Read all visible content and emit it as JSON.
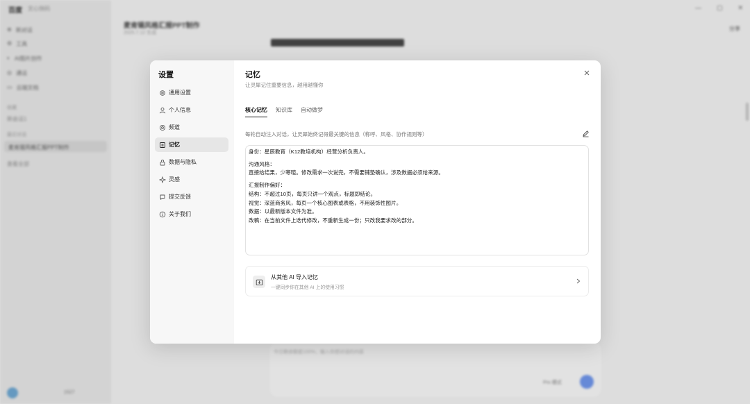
{
  "background": {
    "app_name": "百度",
    "app_sub": "文心快码",
    "nav": [
      "新对话",
      "工具",
      "AI图片创作",
      "通话",
      "云端文档"
    ],
    "sections": [
      "收藏",
      "新会话1",
      "最近对话"
    ],
    "selected_chat": "麦肯锡风格汇报PPT制作",
    "more_item": "查看全部",
    "chat_title": "麦肯锡风格汇报PPT制作",
    "chat_subtitle": "2025.7.12 生成",
    "share_label": "分享",
    "input_placeholder": "今日剩余额度100%，输入你想对话的内容",
    "model_label": "Pro 模式",
    "credits": "1527"
  },
  "settings": {
    "title": "设置",
    "nav": [
      {
        "label": "通用设置",
        "icon": "gear-icon"
      },
      {
        "label": "个人信息",
        "icon": "user-icon"
      },
      {
        "label": "频道",
        "icon": "channel-icon"
      },
      {
        "label": "记忆",
        "icon": "memory-icon",
        "active": true
      },
      {
        "label": "数据与隐私",
        "icon": "lock-icon"
      },
      {
        "label": "灵感",
        "icon": "sparkle-icon"
      },
      {
        "label": "提交反馈",
        "icon": "feedback-icon"
      },
      {
        "label": "关于我们",
        "icon": "info-icon"
      }
    ]
  },
  "memory": {
    "title": "记忆",
    "subtitle": "让灵犀记住重要信息，越用越懂你",
    "tabs": [
      "核心记忆",
      "知识库",
      "自动做梦"
    ],
    "hint": "每轮自动注入对话，让灵犀始终记得最关键的信息（称呼、风格、协作规则等）",
    "lines": [
      "身份：星辰教育（K12教培机构）经营分析负责人。",
      "",
      "沟通风格：",
      "直接给结果，少寒暄。修改需求一次说完，不需要铺垫确认，涉及数据必须给来源。",
      "",
      "汇报制作偏好：",
      "结构：不超过10页，每页只讲一个观点，标题即结论。",
      "视觉：深蓝商务风，每页一个核心图表或表格，不用装饰性图片。",
      "数据：以最新版本文件为准。",
      "改稿：在当前文件上迭代修改，不重新生成一份；只改我要求改的部分。"
    ],
    "import": {
      "title": "从其他 AI 导入记忆",
      "subtitle": "一键同步你在其他 AI 上的使用习惯"
    }
  },
  "colors": {
    "accent": "#1a1a1a",
    "active_bg": "#e6e6e6",
    "send_button": "#6b8fe0"
  }
}
